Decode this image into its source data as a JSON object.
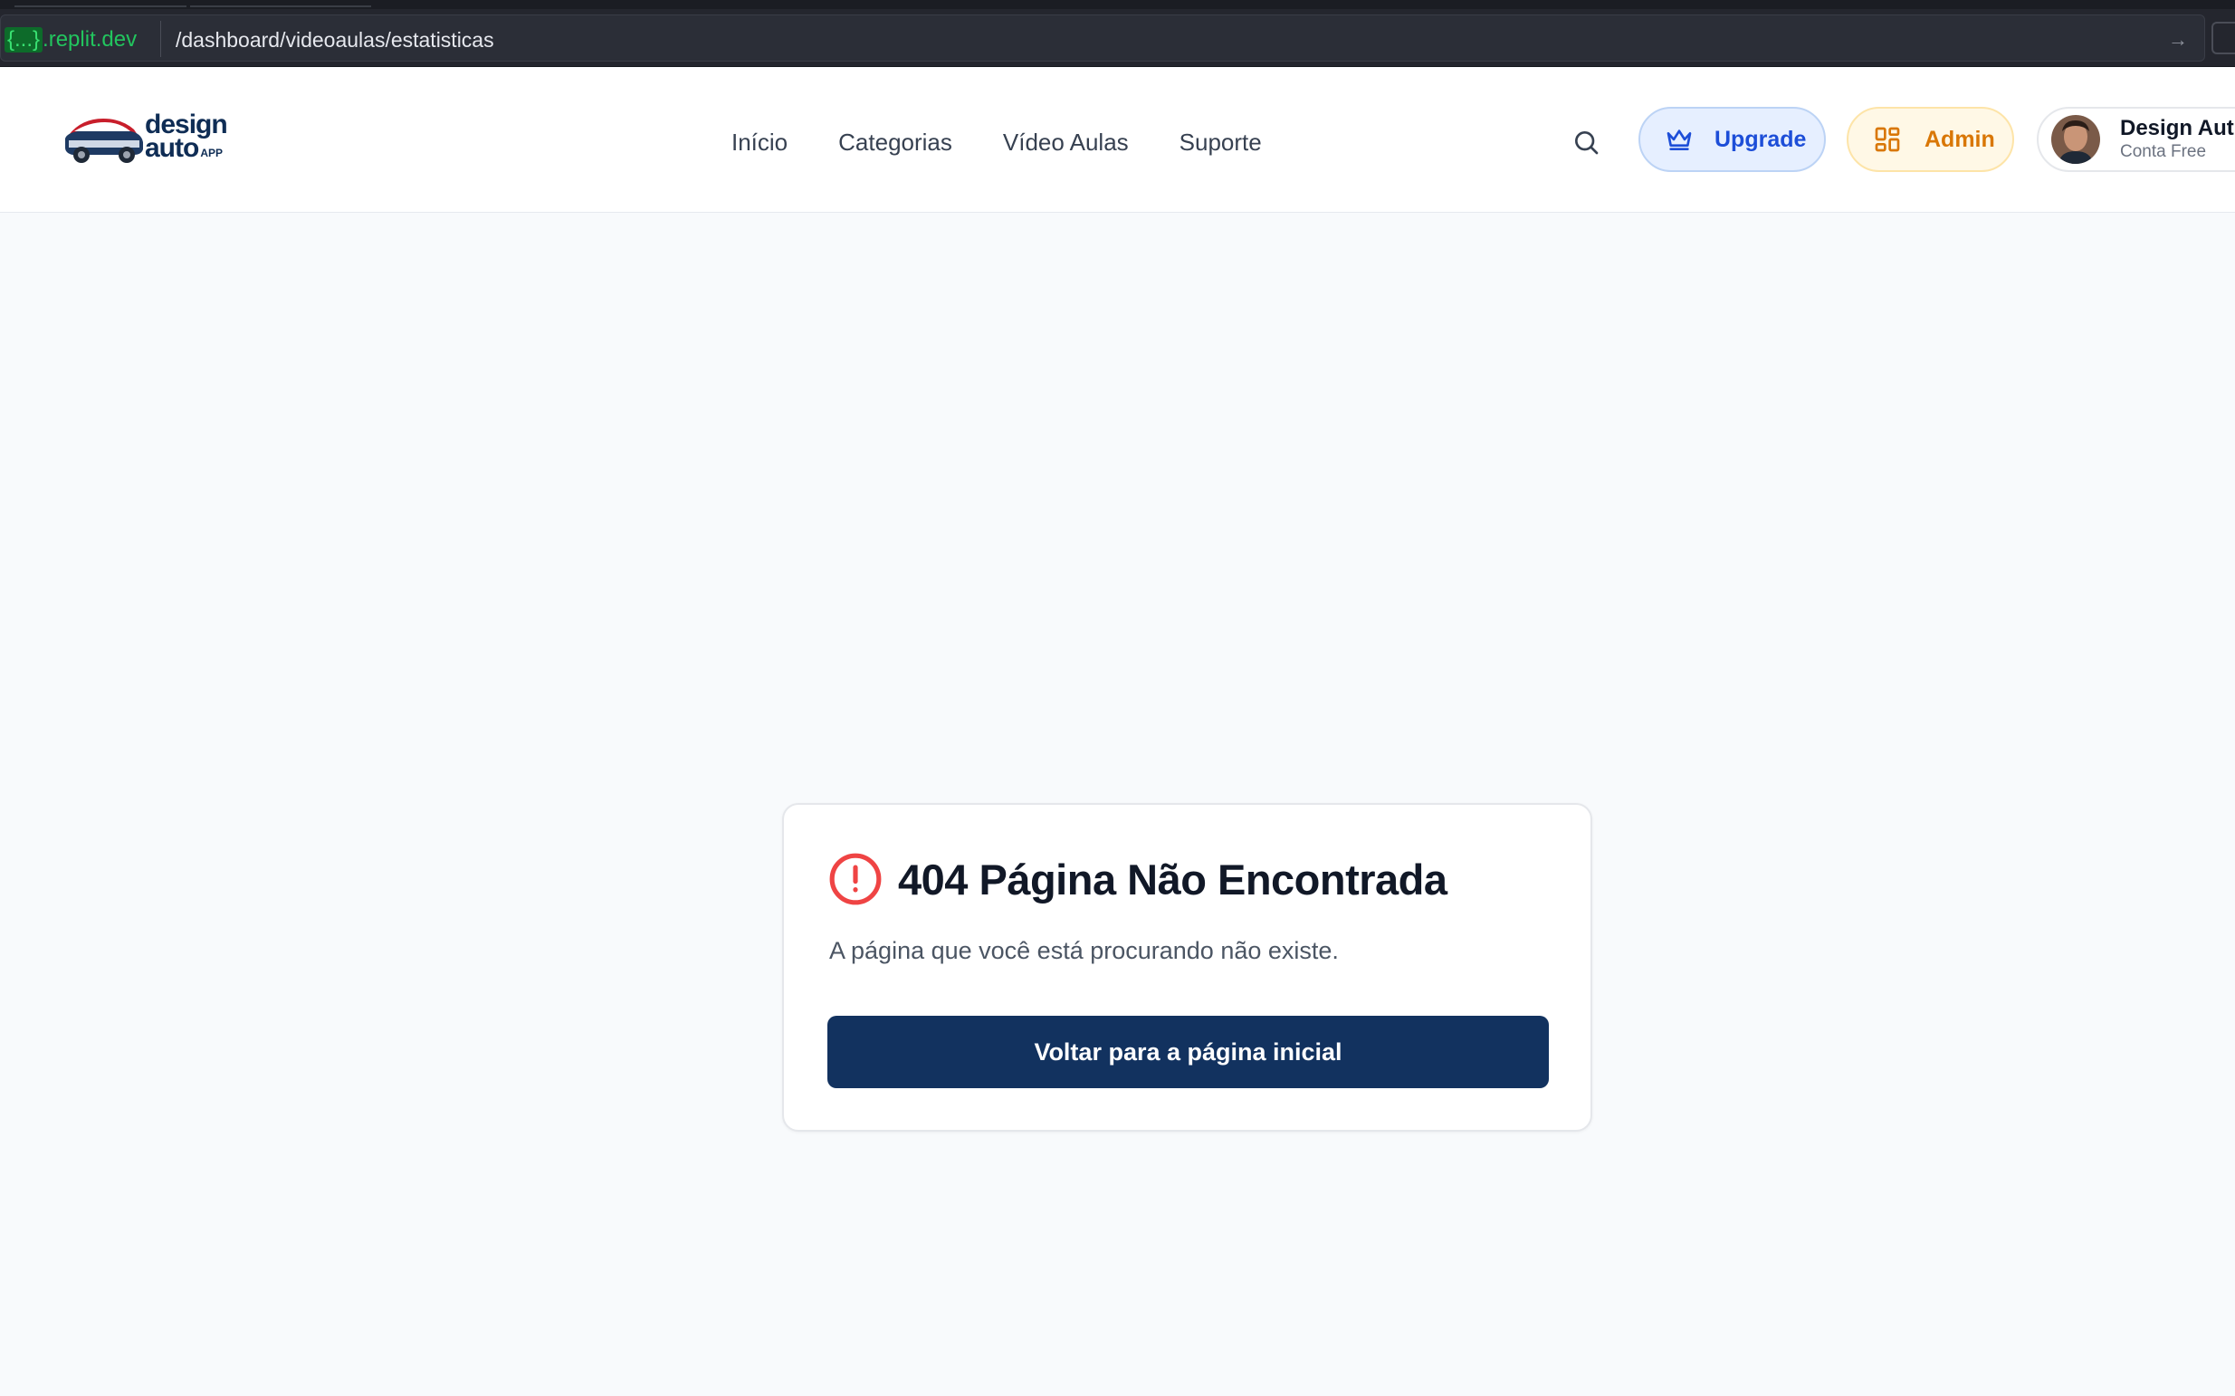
{
  "browser": {
    "domain_badge": "{...}",
    "domain": ".replit.dev",
    "path": "/dashboard/videoaulas/estatisticas",
    "go_icon": "arrow-right-icon"
  },
  "header": {
    "logo": {
      "line1": "design",
      "line2": "auto",
      "line3": "APP"
    },
    "nav": [
      {
        "label": "Início"
      },
      {
        "label": "Categorias"
      },
      {
        "label": "Vídeo Aulas"
      },
      {
        "label": "Suporte"
      }
    ],
    "search_icon": "search-icon",
    "upgrade": {
      "label": "Upgrade",
      "icon": "crown-icon",
      "color": "#1d4ed8"
    },
    "admin": {
      "label": "Admin",
      "icon": "dashboard-grid-icon",
      "color": "#d97706"
    },
    "user": {
      "name": "Design Aut",
      "plan": "Conta Free"
    }
  },
  "error_card": {
    "title": "404 Página Não Encontrada",
    "description": "A página que você está procurando não existe.",
    "button_label": "Voltar para a página inicial",
    "icon": "alert-circle-icon",
    "accent": "#ef4444",
    "button_color": "#12325f"
  }
}
